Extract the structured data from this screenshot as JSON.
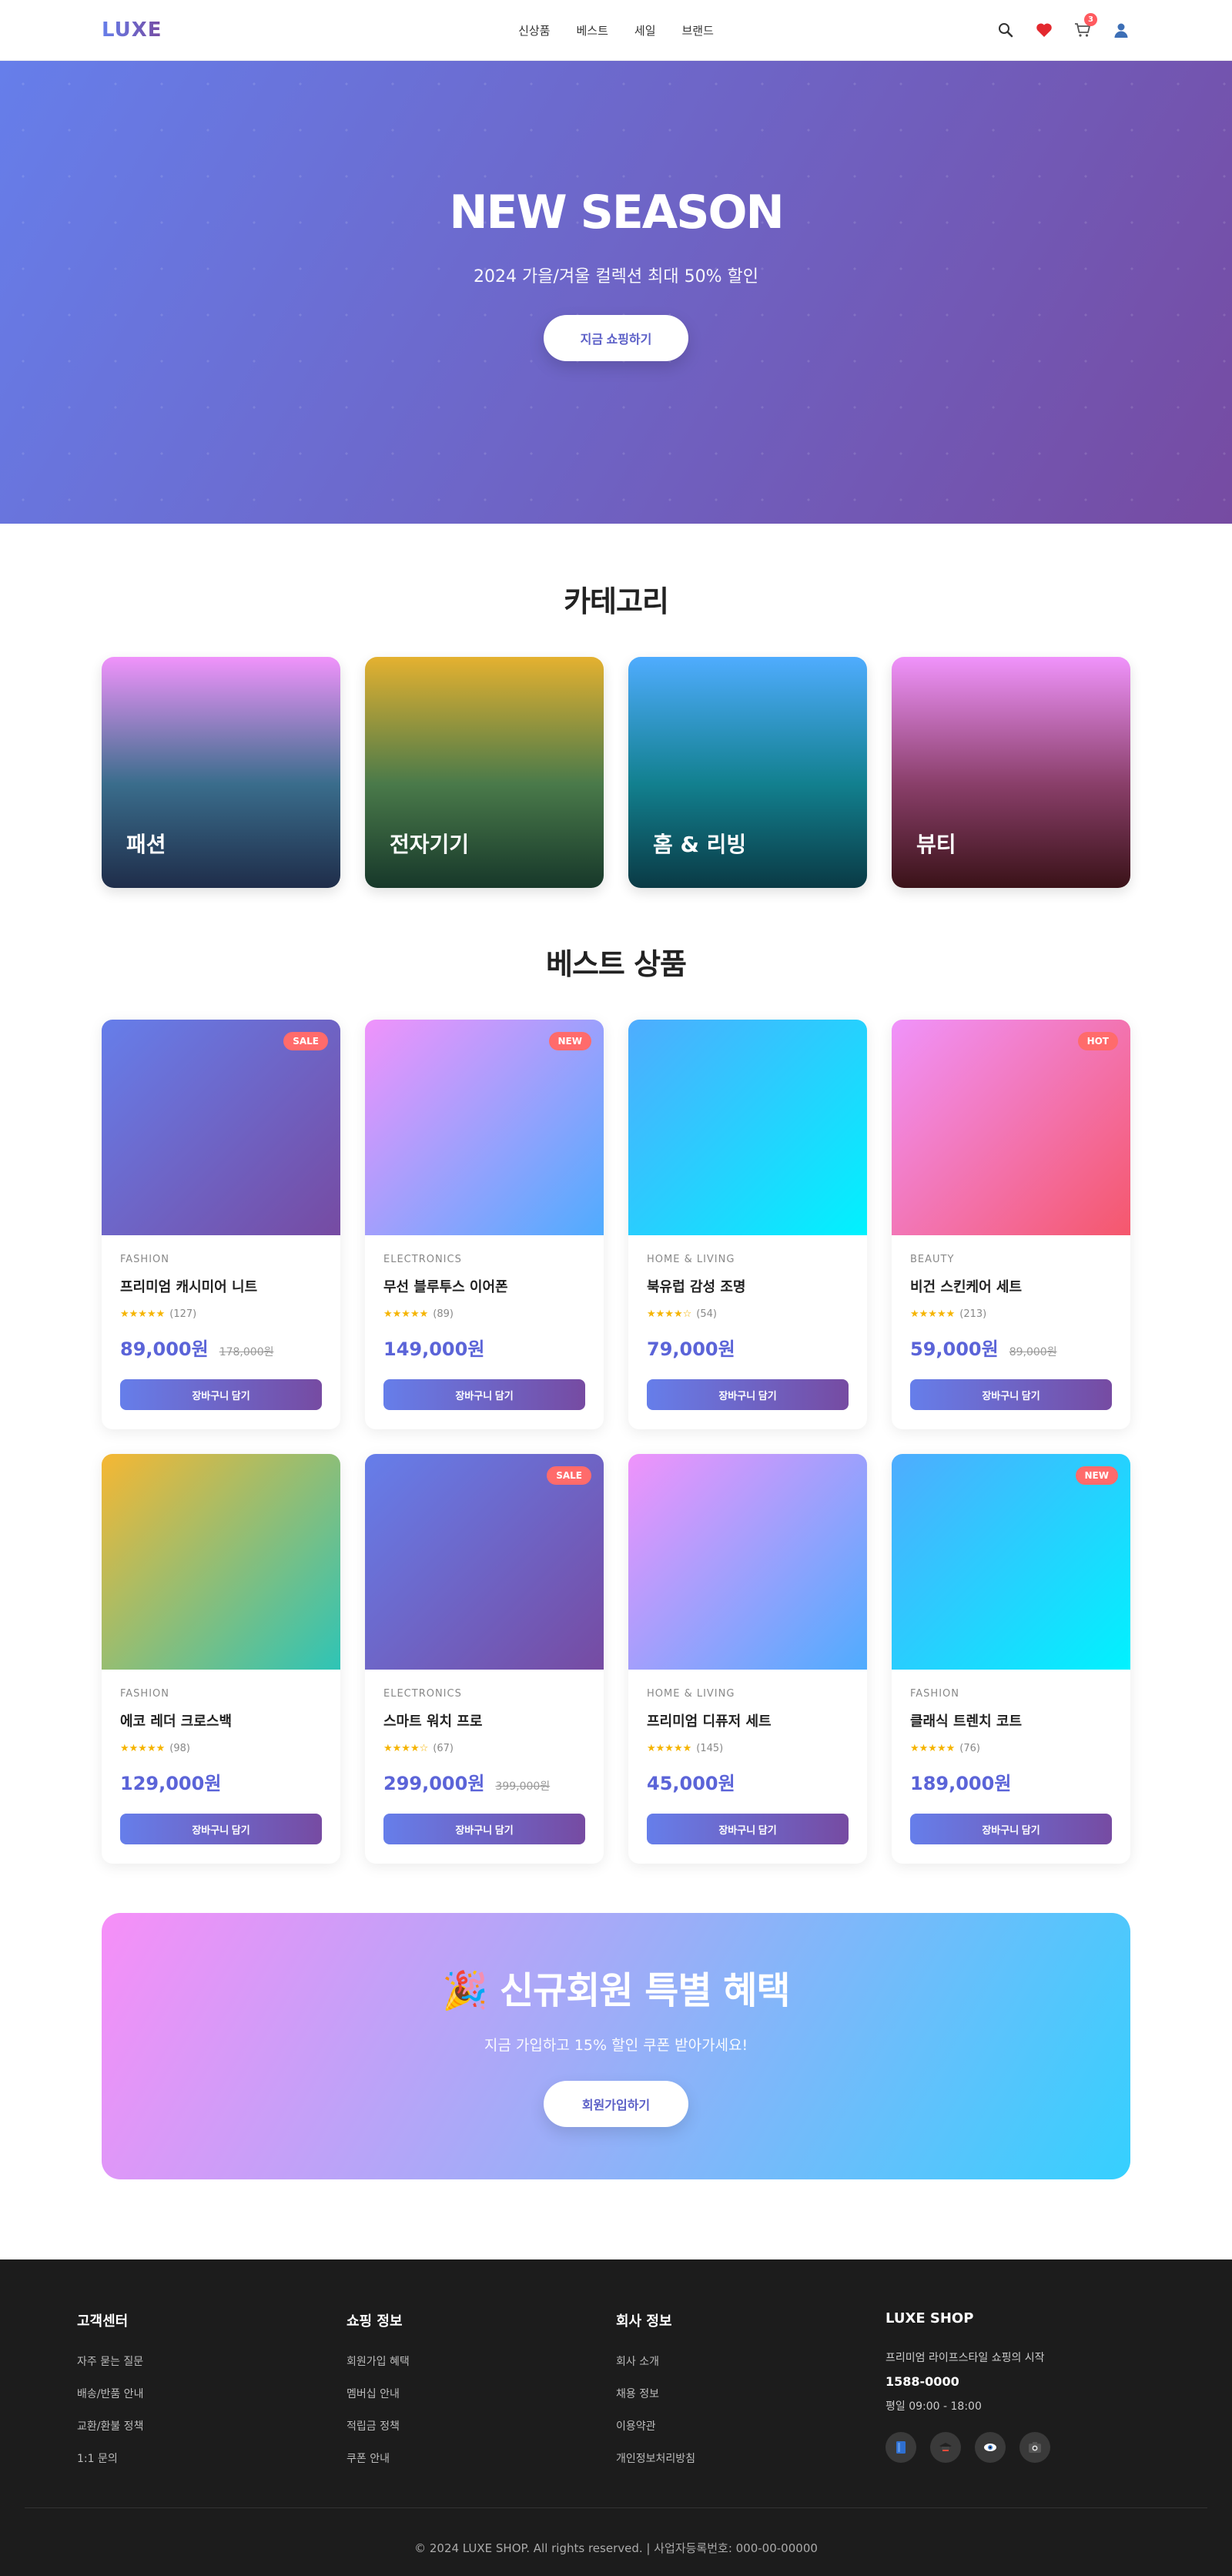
{
  "header": {
    "logo": "LUXE",
    "nav": [
      "신상품",
      "베스트",
      "세일",
      "브랜드"
    ],
    "icons": [
      "search-icon",
      "heart-icon",
      "cart-icon",
      "user-icon"
    ],
    "cart_count": "3"
  },
  "hero": {
    "title": "NEW SEASON",
    "subtitle": "2024 가을/겨울 컬렉션 최대 50% 할인",
    "button": "지금 쇼핑하기"
  },
  "categories": {
    "title": "카테고리",
    "items": [
      {
        "label": "패션"
      },
      {
        "label": "전자기기"
      },
      {
        "label": "홈 & 리빙"
      },
      {
        "label": "뷰티"
      }
    ]
  },
  "best": {
    "title": "베스트 상품",
    "button_label": "장바구니 담기",
    "products": [
      {
        "category": "FASHION",
        "name": "프리미엄 캐시미어 니트",
        "stars": "★★★★★",
        "reviews": "(127)",
        "price": "89,000원",
        "old_price": "178,000원",
        "badge": "SALE",
        "gradient": "g-a"
      },
      {
        "category": "ELECTRONICS",
        "name": "무선 블루투스 이어폰",
        "stars": "★★★★★",
        "reviews": "(89)",
        "price": "149,000원",
        "old_price": "",
        "badge": "NEW",
        "gradient": "g-b"
      },
      {
        "category": "HOME & LIVING",
        "name": "북유럽 감성 조명",
        "stars": "★★★★☆",
        "reviews": "(54)",
        "price": "79,000원",
        "old_price": "",
        "badge": "",
        "gradient": "g-c"
      },
      {
        "category": "BEAUTY",
        "name": "비건 스킨케어 세트",
        "stars": "★★★★★",
        "reviews": "(213)",
        "price": "59,000원",
        "old_price": "89,000원",
        "badge": "HOT",
        "gradient": "g-d"
      },
      {
        "category": "FASHION",
        "name": "에코 레더 크로스백",
        "stars": "★★★★★",
        "reviews": "(98)",
        "price": "129,000원",
        "old_price": "",
        "badge": "",
        "gradient": "g-e"
      },
      {
        "category": "ELECTRONICS",
        "name": "스마트 워치 프로",
        "stars": "★★★★☆",
        "reviews": "(67)",
        "price": "299,000원",
        "old_price": "399,000원",
        "badge": "SALE",
        "gradient": "g-a"
      },
      {
        "category": "HOME & LIVING",
        "name": "프리미엄 디퓨저 세트",
        "stars": "★★★★★",
        "reviews": "(145)",
        "price": "45,000원",
        "old_price": "",
        "badge": "",
        "gradient": "g-b"
      },
      {
        "category": "FASHION",
        "name": "클래식 트렌치 코트",
        "stars": "★★★★★",
        "reviews": "(76)",
        "price": "189,000원",
        "old_price": "",
        "badge": "NEW",
        "gradient": "g-c"
      }
    ]
  },
  "promo": {
    "emoji": "🎉",
    "title": "신규회원 특별 혜택",
    "subtitle": "지금 가입하고 15% 할인 쿠폰 받아가세요!",
    "button": "회원가입하기"
  },
  "footer": {
    "columns": [
      {
        "title": "고객센터",
        "links": [
          "자주 묻는 질문",
          "배송/반품 안내",
          "교환/환불 정책",
          "1:1 문의"
        ]
      },
      {
        "title": "쇼핑 정보",
        "links": [
          "회원가입 혜택",
          "멤버십 안내",
          "적립금 정책",
          "쿠폰 안내"
        ]
      },
      {
        "title": "회사 정보",
        "links": [
          "회사 소개",
          "채용 정보",
          "이용약관",
          "개인정보처리방침"
        ]
      }
    ],
    "shop": {
      "title": "LUXE SHOP",
      "desc": "프리미엄 라이프스타일 쇼핑의 시작",
      "phone": "1588-0000",
      "hours": "평일 09:00 - 18:00",
      "socials": [
        "book-icon",
        "cap-icon",
        "eye-icon",
        "camera-icon"
      ]
    },
    "copyright": "© 2024 LUXE SHOP. All rights reserved. | 사업자등록번호: 000-00-00000"
  }
}
